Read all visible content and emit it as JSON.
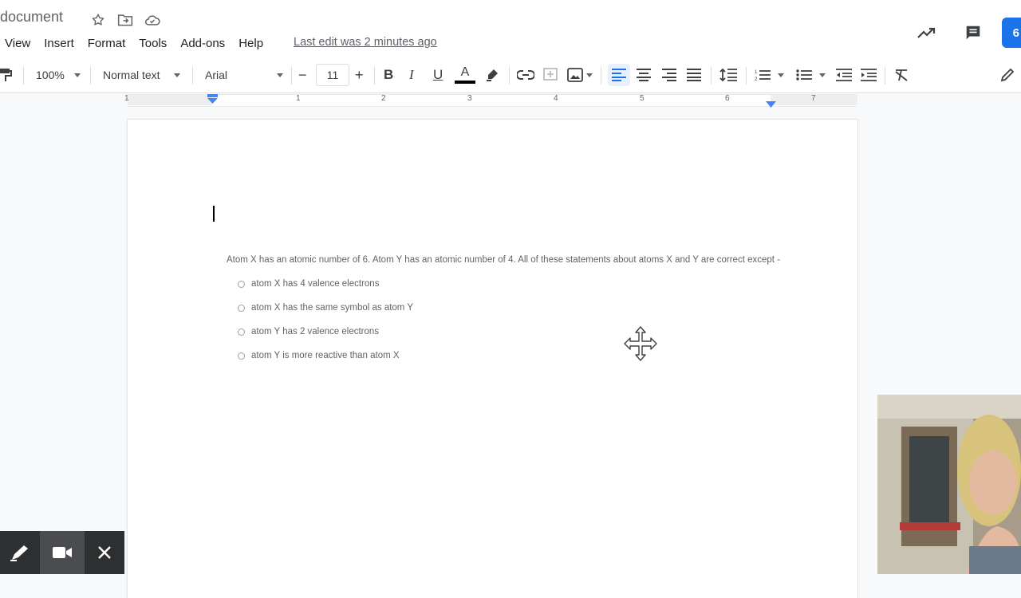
{
  "titlebar": {
    "doc_title": "document",
    "menu": [
      "View",
      "Insert",
      "Format",
      "Tools",
      "Add-ons",
      "Help"
    ],
    "last_edit": "Last edit was 2 minutes ago",
    "share_glyph": "6"
  },
  "toolbar": {
    "zoom": "100%",
    "style": "Normal text",
    "font": "Arial",
    "font_size": "11",
    "minus": "−",
    "plus": "+",
    "bold": "B",
    "italic": "I",
    "underline": "U",
    "text_color_glyph": "A",
    "text_color": "#000000"
  },
  "ruler": {
    "numbers": [
      "1",
      "1",
      "2",
      "3",
      "4",
      "5",
      "6",
      "7"
    ]
  },
  "document": {
    "question": "Atom X has an atomic number of 6. Atom Y has an atomic number of 4. All of these statements about atoms X and Y are correct except -",
    "options": [
      "atom X has 4 valence electrons",
      "atom X has the same symbol as atom Y",
      "atom Y has 2 valence electrons",
      "atom Y is more reactive than atom X"
    ]
  },
  "colors": {
    "accent": "#1a73e8",
    "active_bg": "#e8f0fe",
    "recorder_bg": "#2d2f31"
  }
}
